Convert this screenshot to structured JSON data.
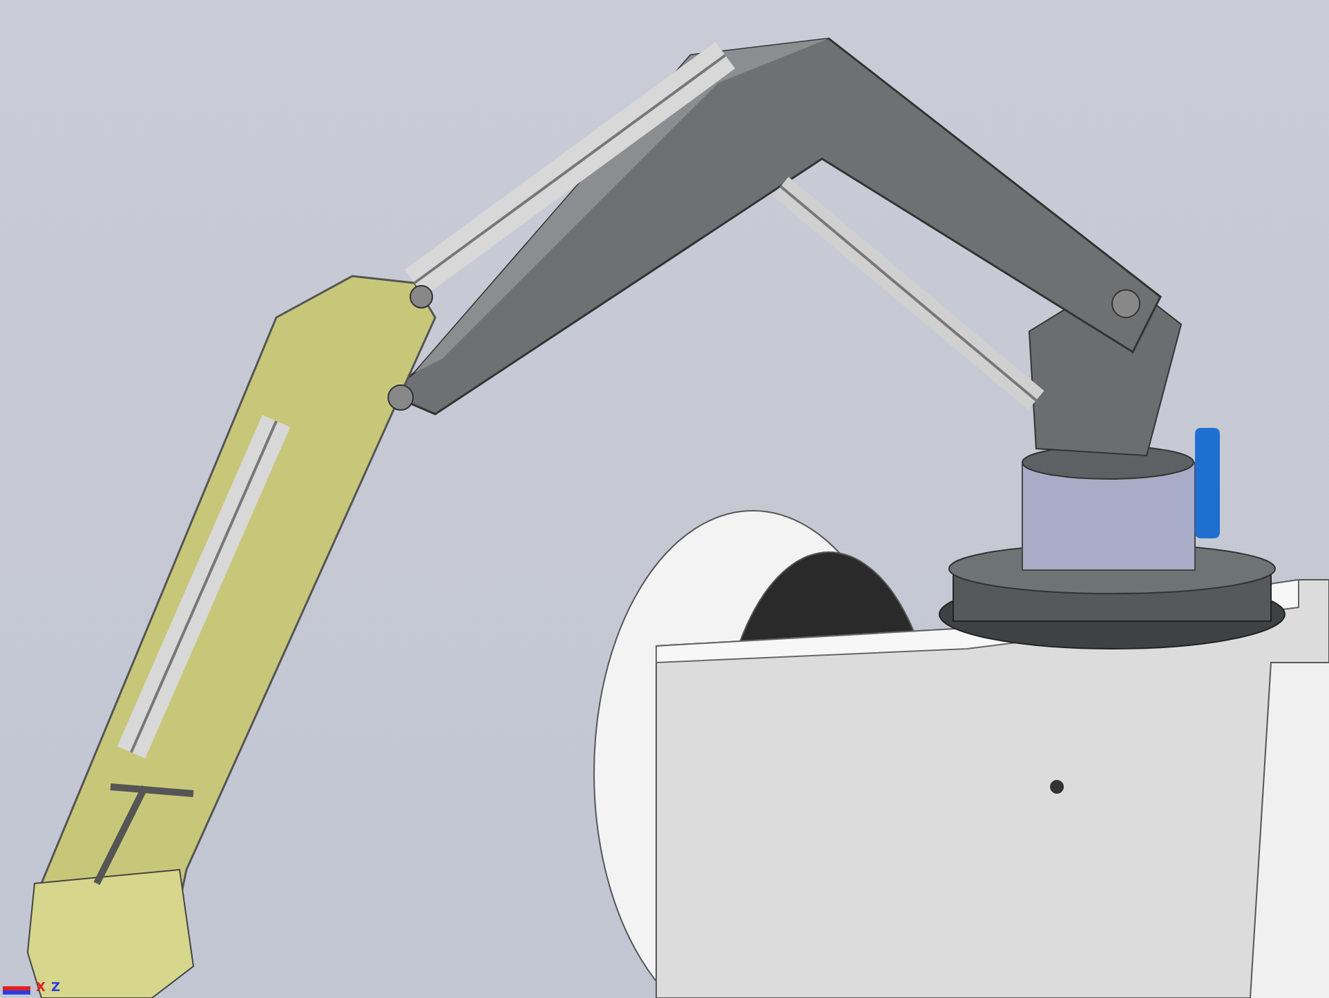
{
  "viewport": {
    "triad": {
      "axes": [
        {
          "label": "X",
          "color": "#e02020"
        },
        {
          "label": "Z",
          "color": "#2a3fe0"
        }
      ]
    }
  }
}
